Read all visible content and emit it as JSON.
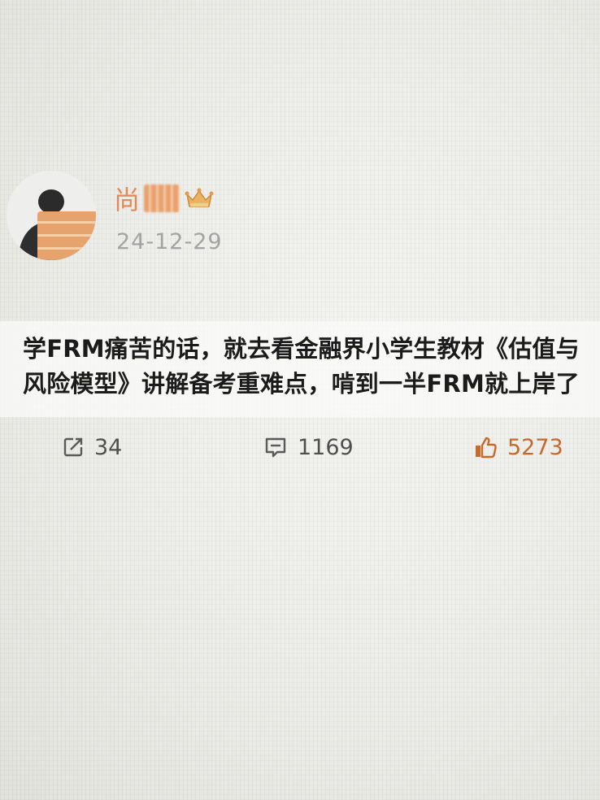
{
  "post": {
    "author": {
      "name_visible": "尚",
      "badge_icon": "crown-icon"
    },
    "timestamp": "24-12-29",
    "content": {
      "line1": "学FRM痛苦的话，就去看金融界小学生教材《估值与",
      "line2": "风险模型》讲解备考重难点，啃到一半FRM就上岸了"
    },
    "actions": {
      "share": {
        "icon": "share-icon",
        "count": "34"
      },
      "comment": {
        "icon": "comment-icon",
        "count": "1169"
      },
      "like": {
        "icon": "thumbs-up-icon",
        "count": "5273"
      }
    }
  },
  "colors": {
    "username": "#e08a57",
    "timestamp": "#a3a3a3",
    "text": "#1b1b1b",
    "action_text": "#4f4f4f",
    "like_accent": "#c5692f"
  }
}
